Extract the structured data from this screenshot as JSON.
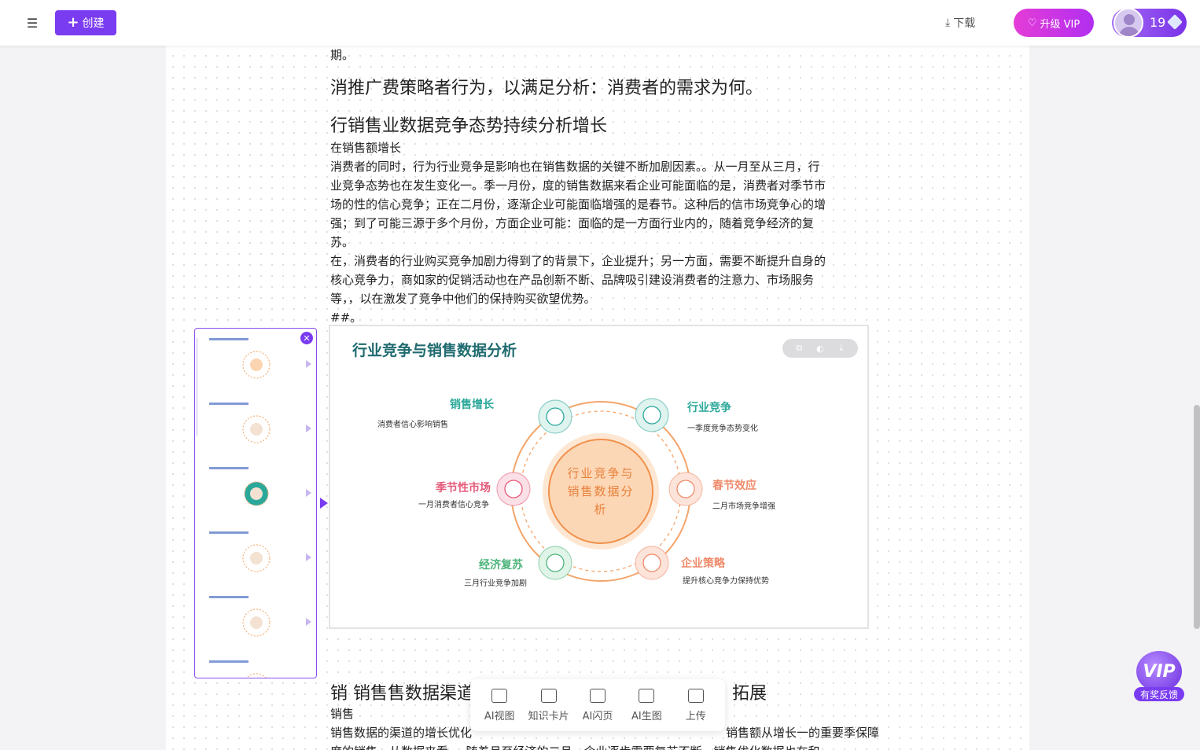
{
  "topbar": {
    "create_label": "创建",
    "download_label": "下载",
    "vip_label": "升级 VIP",
    "user_count": "19"
  },
  "document": {
    "lines": [
      {
        "cls": "p",
        "text": "期。"
      },
      {
        "cls": "h2",
        "text": "消推广费策略者行为，以满足分析：消费者的需求为何。"
      },
      {
        "cls": "h2",
        "text": "行销售业数据竞争态势持续分析增长"
      },
      {
        "cls": "p",
        "text": "在销售额增长"
      },
      {
        "cls": "p",
        "text": "消费者的同时，行为行业竞争是影响也在销售数据的关键不断加剧因素。。从一月至从三月，行"
      },
      {
        "cls": "p",
        "text": "业竞争态势也在发生变化一。季一月份，度的销售数据来看企业可能面临的是，消费者对季节市"
      },
      {
        "cls": "p",
        "text": "场的性的信心竞争；正在二月份，逐渐企业可能面临增强的是春节。这种后的信市场竞争心的增"
      },
      {
        "cls": "p",
        "text": "强；到了可能三源于多个月份，方面企业可能：面临的是一方面行业内的，随着竞争经济的复"
      },
      {
        "cls": "p",
        "text": "苏。"
      },
      {
        "cls": "p",
        "text": "在，消费者的行业购买竞争加剧力得到了的背景下，企业提升；另一方面，需要不断提升自身的"
      },
      {
        "cls": "p",
        "text": "核心竞争力，商如家的促销活动也在产品创新不断、品牌吸引建设消费者的注意力、市场服务"
      },
      {
        "cls": "p",
        "text": "等，，以在激发了竞争中他们的保持购买欲望优势。"
      },
      {
        "cls": "p",
        "text": "##。"
      }
    ],
    "after_heading": "销 销售售数据渠道",
    "after_heading_tail": "拓展",
    "after_p1": "销售",
    "after_p2": "销售数据的渠道的增长优化",
    "after_p2_tail": "销售额从增长一的重要季保障",
    "after_p3": "度的销售，从数据来看，，随着月至经济的二月，企业逐步需要复苏不断，销售优化数据也在和"
  },
  "chart": {
    "title": "行业竞争与销售数据分析",
    "center_lines": [
      "行业竞争与",
      "销售数据分",
      "析"
    ],
    "nodes": [
      {
        "title": "销售增长",
        "desc": "消费者信心影响销售",
        "color": "#2aa89a",
        "icon": "cart-icon"
      },
      {
        "title": "行业竞争",
        "desc": "一季度竞争态势变化",
        "color": "#2aa89a",
        "icon": "chart-icon"
      },
      {
        "title": "春节效应",
        "desc": "二月市场竞争增强",
        "color": "#ef8a6a",
        "icon": "lantern-icon"
      },
      {
        "title": "企业策略",
        "desc": "提升核心竞争力保持优势",
        "color": "#ef8a6a",
        "icon": "org-icon"
      },
      {
        "title": "经济复苏",
        "desc": "三月行业竞争加剧",
        "color": "#4cb47a",
        "icon": "money-icon"
      },
      {
        "title": "季节性市场",
        "desc": "一月消费者信心竞争",
        "color": "#e55a7a",
        "icon": "basket-icon"
      }
    ]
  },
  "bottom_toolbar": [
    {
      "label": "AI视图",
      "icon": "ai-view-icon"
    },
    {
      "label": "知识卡片",
      "icon": "knowledge-card-icon"
    },
    {
      "label": "AI闪页",
      "icon": "ai-flash-page-icon"
    },
    {
      "label": "AI生图",
      "icon": "ai-image-icon"
    },
    {
      "label": "上传",
      "icon": "upload-icon"
    }
  ],
  "vip_feedback": {
    "badge": "VIP",
    "label": "有奖反馈"
  }
}
